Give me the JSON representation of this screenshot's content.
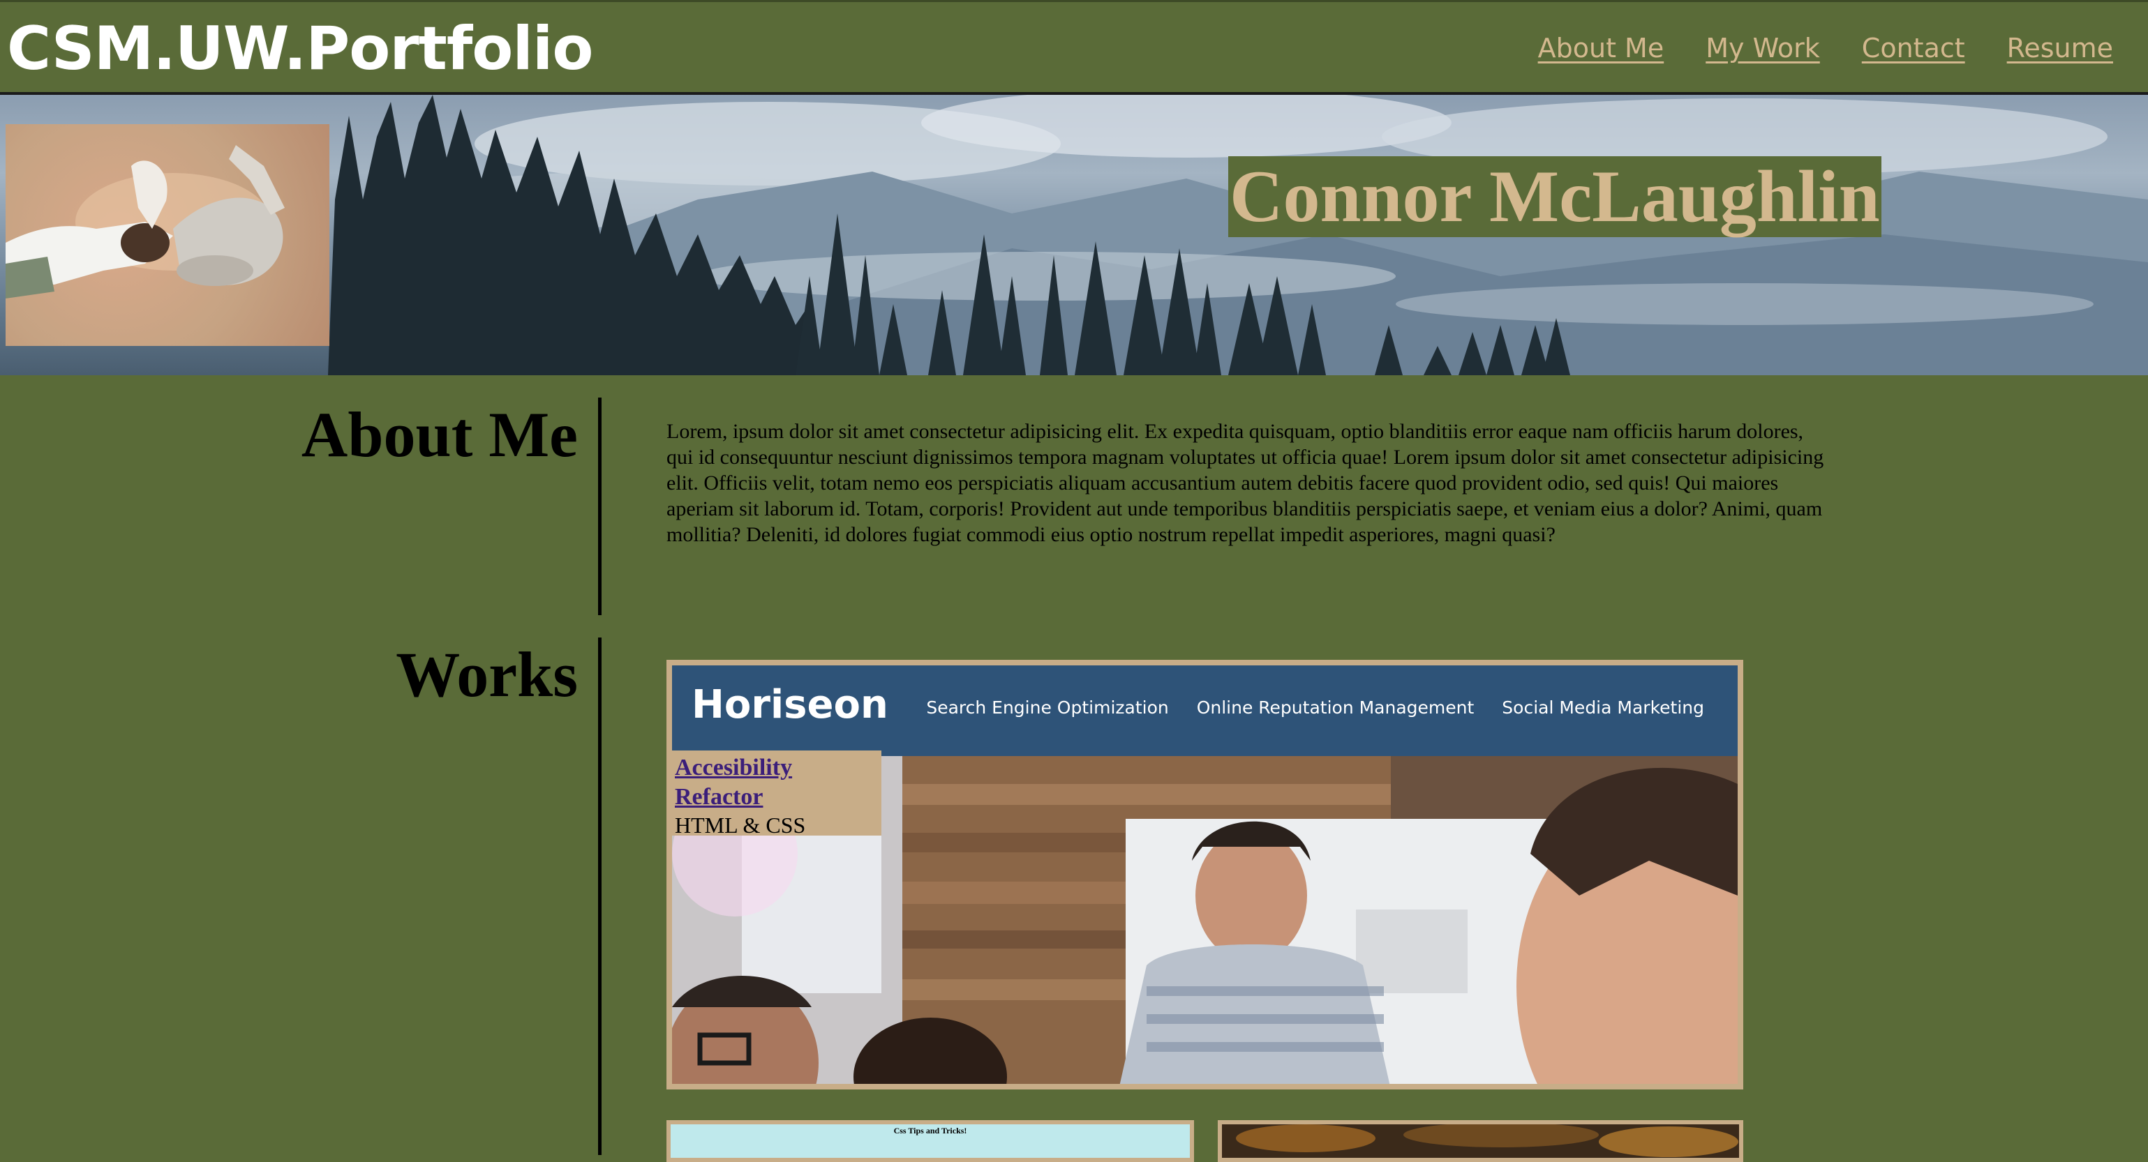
{
  "header": {
    "brand": "CSM.UW.Portfolio",
    "nav": [
      "About Me",
      "My Work",
      "Contact",
      "Resume"
    ]
  },
  "hero": {
    "name": "Connor McLaughlin"
  },
  "about": {
    "title": "About Me",
    "text": "Lorem, ipsum dolor sit amet consectetur adipisicing elit. Ex expedita quisquam, optio blanditiis error eaque nam officiis harum dolores, qui id consequuntur nesciunt dignissimos tempora magnam voluptates ut officia quae! Lorem ipsum dolor sit amet consectetur adipisicing elit. Officiis velit, totam nemo eos perspiciatis aliquam accusantium autem debitis facere quod provident odio, sed quis! Qui maiores aperiam sit laborum id. Totam, corporis! Provident aut unde temporibus blanditiis perspiciatis saepe, et veniam eius a dolor? Animi, quam mollitia? Deleniti, id dolores fugiat commodi eius optio nostrum repellat impedit asperiores, magni quasi?"
  },
  "works": {
    "title": "Works",
    "featured": {
      "site_logo": "Horiseon",
      "site_links": [
        "Search Engine Optimization",
        "Online Reputation Management",
        "Social Media Marketing"
      ],
      "link1": "Accesibility",
      "link2": "Refactor",
      "tech": "HTML & CSS"
    },
    "thumb_left_title": "Css Tips and Tricks!"
  },
  "colors": {
    "background": "#5a6b38",
    "accent_tan": "#d3b88e",
    "card_border": "#c8ad88",
    "horiseon_nav": "#2e5378"
  },
  "icons": [
    "portrait-photo",
    "mountain-forest-banner",
    "office-team-photo"
  ]
}
